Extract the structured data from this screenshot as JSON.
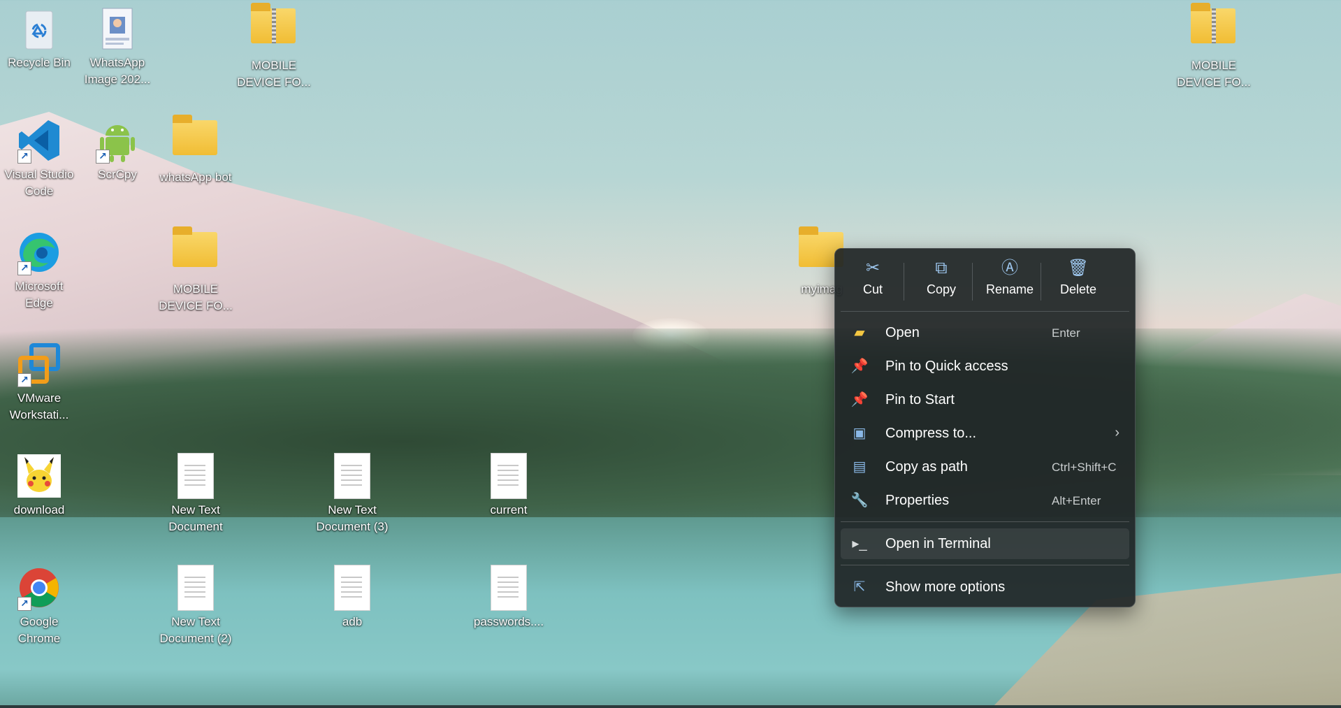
{
  "desktop": {
    "icons": [
      {
        "label": "Recycle Bin",
        "icon": "recycle-bin-icon"
      },
      {
        "label": "WhatsApp Image 202...",
        "icon": "image-file-icon"
      },
      {
        "label": "MOBILE DEVICE FO...",
        "icon": "zip-folder-icon"
      },
      {
        "label": "MOBILE DEVICE FO...",
        "icon": "zip-folder-icon"
      },
      {
        "label": "Visual Studio Code",
        "icon": "vscode-icon"
      },
      {
        "label": "ScrCpy",
        "icon": "android-icon"
      },
      {
        "label": "whatsApp bot",
        "icon": "folder-icon"
      },
      {
        "label": "Microsoft Edge",
        "icon": "edge-icon"
      },
      {
        "label": "MOBILE DEVICE FO...",
        "icon": "folder-icon"
      },
      {
        "label": "myimag",
        "icon": "folder-icon"
      },
      {
        "label": "VMware Workstati...",
        "icon": "vmware-icon"
      },
      {
        "label": "download",
        "icon": "image-file-icon"
      },
      {
        "label": "New Text Document",
        "icon": "text-file-icon"
      },
      {
        "label": "New Text Document (3)",
        "icon": "text-file-icon"
      },
      {
        "label": "current",
        "icon": "text-file-icon"
      },
      {
        "label": "Google Chrome",
        "icon": "chrome-icon"
      },
      {
        "label": "New Text Document (2)",
        "icon": "text-file-icon"
      },
      {
        "label": "adb",
        "icon": "text-file-icon"
      },
      {
        "label": "passwords....",
        "icon": "text-file-icon"
      }
    ]
  },
  "context_menu": {
    "quick_actions": [
      {
        "label": "Cut",
        "icon": "scissors-icon"
      },
      {
        "label": "Copy",
        "icon": "copy-icon"
      },
      {
        "label": "Rename",
        "icon": "rename-icon"
      },
      {
        "label": "Delete",
        "icon": "trash-icon"
      }
    ],
    "items": [
      {
        "label": "Open",
        "shortcut": "Enter",
        "icon": "folder-open-icon"
      },
      {
        "label": "Pin to Quick access",
        "shortcut": "",
        "icon": "pin-icon"
      },
      {
        "label": "Pin to Start",
        "shortcut": "",
        "icon": "pin-icon"
      },
      {
        "label": "Compress to...",
        "shortcut": "",
        "icon": "zip-icon",
        "submenu": true
      },
      {
        "label": "Copy as path",
        "shortcut": "Ctrl+Shift+C",
        "icon": "path-icon"
      },
      {
        "label": "Properties",
        "shortcut": "Alt+Enter",
        "icon": "wrench-icon"
      },
      {
        "label": "Open in Terminal",
        "shortcut": "",
        "icon": "terminal-icon"
      },
      {
        "label": "Show more options",
        "shortcut": "",
        "icon": "share-icon"
      }
    ]
  }
}
